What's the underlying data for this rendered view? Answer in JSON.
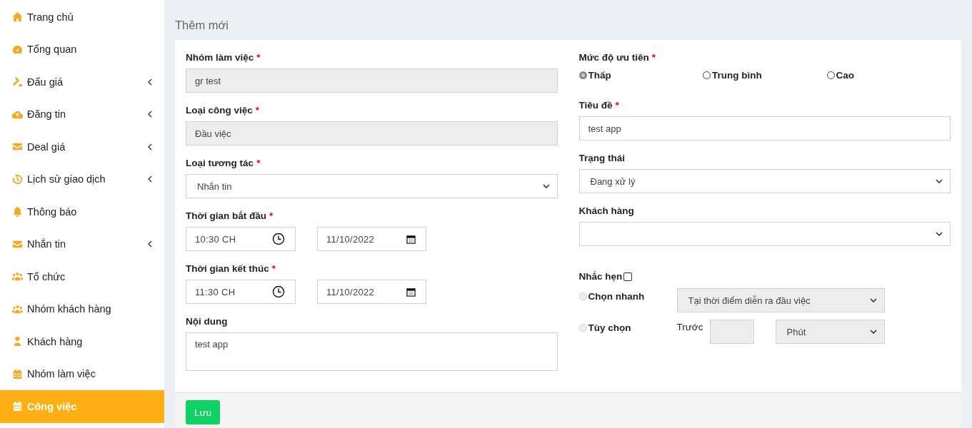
{
  "sidebar": {
    "items": [
      {
        "label": "Trang chủ",
        "expandable": false,
        "selected": false
      },
      {
        "label": "Tổng quan",
        "expandable": false,
        "selected": false
      },
      {
        "label": "Đấu giá",
        "expandable": true,
        "selected": false
      },
      {
        "label": "Đăng tin",
        "expandable": true,
        "selected": false
      },
      {
        "label": "Deal giá",
        "expandable": true,
        "selected": false
      },
      {
        "label": "Lịch sử giao dịch",
        "expandable": true,
        "selected": false
      },
      {
        "label": "Thông báo",
        "expandable": false,
        "selected": false
      },
      {
        "label": "Nhắn tin",
        "expandable": true,
        "selected": false
      },
      {
        "label": "Tổ chức",
        "expandable": false,
        "selected": false
      },
      {
        "label": "Nhóm khách hàng",
        "expandable": false,
        "selected": false
      },
      {
        "label": "Khách hàng",
        "expandable": false,
        "selected": false
      },
      {
        "label": "Nhóm làm việc",
        "expandable": false,
        "selected": false
      },
      {
        "label": "Công việc",
        "expandable": false,
        "selected": true
      }
    ]
  },
  "page_title": "Thêm mới",
  "form": {
    "left": [
      {
        "kind": "text",
        "label": "Nhóm làm việc",
        "required_mark": "*",
        "value": "gr test",
        "disabled": true
      },
      {
        "kind": "text",
        "label": "Loại công việc",
        "required_mark": "*",
        "value": "Đầu việc",
        "disabled": true
      },
      {
        "kind": "select",
        "label": "Loại tương tác",
        "required_mark": "*",
        "value": "Nhắn tin",
        "disabled": false
      },
      {
        "kind": "datetime",
        "label": "Thời gian bắt đầu",
        "required_mark": "*",
        "time": "10:30 CH",
        "date": "11/10/2022"
      },
      {
        "kind": "datetime",
        "label": "Thời gian kết thúc",
        "required_mark": "*",
        "time": "11:30 CH",
        "date": "11/10/2022"
      },
      {
        "kind": "textarea",
        "label": "Nội dung",
        "value": "test app"
      }
    ],
    "right": [
      {
        "kind": "radios",
        "label": "Mức độ ưu tiên",
        "required_mark": "*",
        "options": [
          {
            "label": "Thấp",
            "selected": true
          },
          {
            "label": "Trung bình",
            "selected": false
          },
          {
            "label": "Cao",
            "selected": false
          }
        ]
      },
      {
        "kind": "text",
        "label": "Tiêu đề",
        "required_mark": "*",
        "value": "test app",
        "disabled": false
      },
      {
        "kind": "select",
        "label": "Trạng thái",
        "value": "Đang xử lý",
        "disabled": false
      },
      {
        "kind": "select",
        "label": "Khách hàng",
        "disabled": false
      }
    ],
    "reminder": {
      "label": "Nhắc hẹn",
      "checked": false,
      "quick": {
        "label": "Chọn nhanh",
        "selected": false,
        "disabled": true,
        "value": "Tại thời điểm diễn ra đầu việc"
      },
      "custom": {
        "label": "Tùy chọn",
        "selected": false,
        "disabled": true,
        "before_label": "Trước",
        "unit": "Phút"
      }
    }
  },
  "footer": {
    "save_button": "Lưu"
  }
}
